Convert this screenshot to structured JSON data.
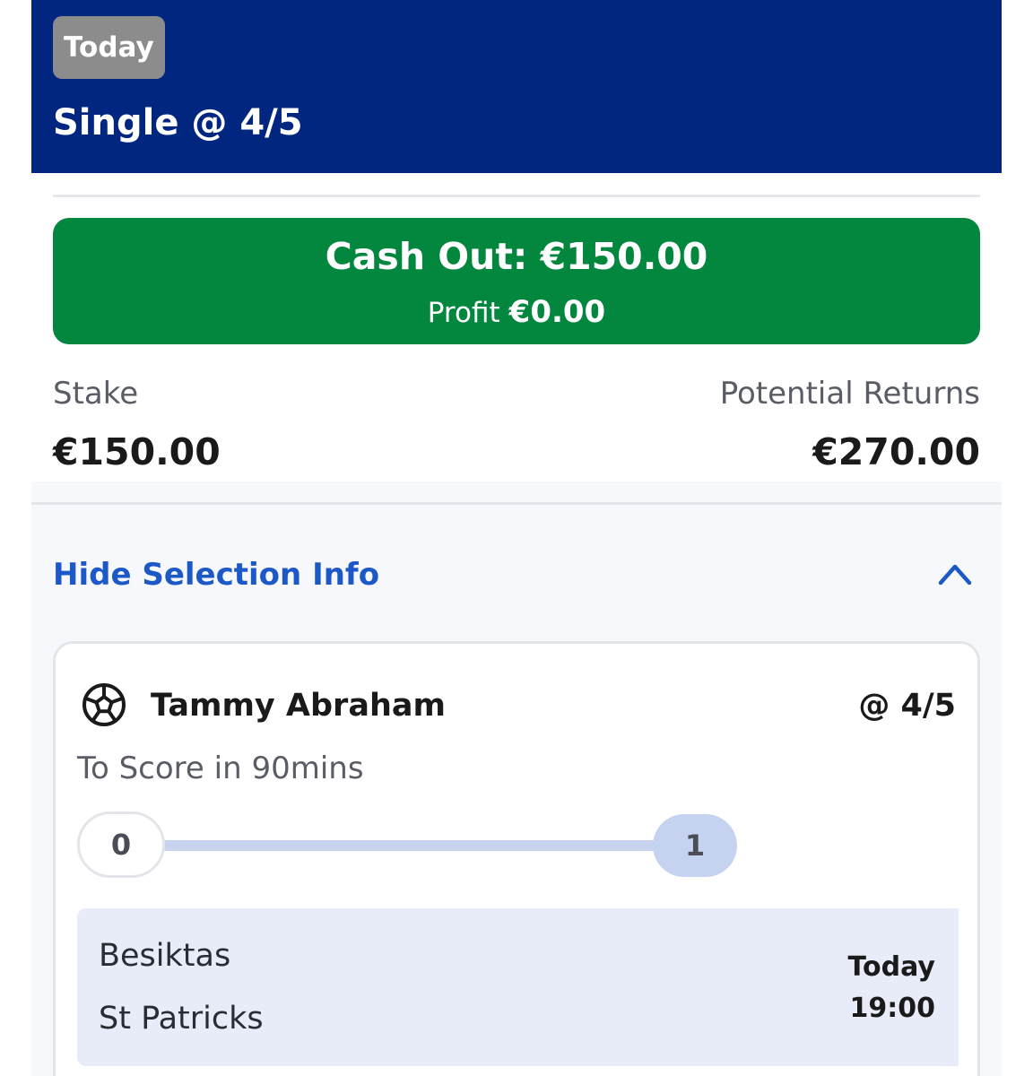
{
  "header": {
    "date_badge": "Today",
    "bet_title": "Single @ 4/5",
    "background_color": "#002680"
  },
  "cashout": {
    "label": "Cash Out: €150.00",
    "profit_label": "Profit",
    "profit_value": "€0.00",
    "color": "#03863d"
  },
  "summary": {
    "stake_label": "Stake",
    "stake_value": "€150.00",
    "returns_label": "Potential Returns",
    "returns_value": "€270.00"
  },
  "selection_toggle": {
    "label": "Hide Selection Info",
    "icon": "chevron-up-icon",
    "color": "#1d59c6"
  },
  "selection": {
    "sport_icon": "football-icon",
    "player": "Tammy Abraham",
    "odds": "@ 4/5",
    "market": "To Score in 90mins",
    "progress": {
      "start": "0",
      "end": "1"
    },
    "event": {
      "home_team": "Besiktas",
      "away_team": "St Patricks",
      "day": "Today",
      "time": "19:00"
    }
  }
}
